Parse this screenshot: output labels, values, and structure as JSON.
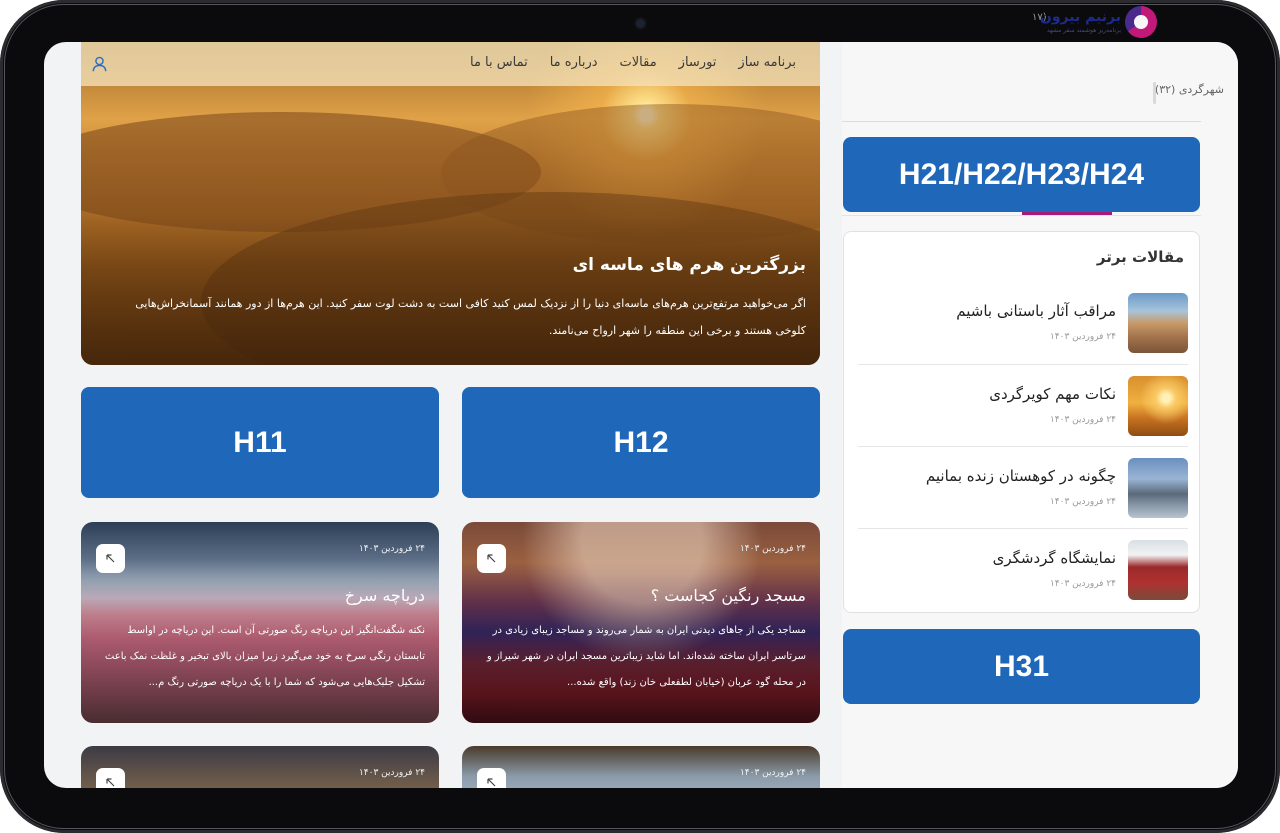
{
  "nav": {
    "links": [
      "برنامه ساز",
      "تورساز",
      "مقالات",
      "درباره ما",
      "تماس با ما"
    ]
  },
  "hero": {
    "title": "بزرگترین هرم های ماسه ای",
    "text": "اگر می‌خواهید مرتفع‌ترین هرم‌های ماسه‌ای دنیا را از نزدیک لمس کنید کافی است به دشت لوت سفر کنید. این هرم‌ها از دور همانند آسمانخراش‌هایی کلوخی هستند و برخی این منطقه را شهر ارواح می‌نامند."
  },
  "placeholders": {
    "h11": "H11",
    "h12": "H12",
    "h21_24": "H21/H22/H23/H24",
    "h31": "H31"
  },
  "cards": [
    {
      "date": "۲۴ فروردین ۱۴۰۳",
      "title": "دریاچه سرخ",
      "text": "نکته شگفت‌انگیز این دریاچه رنگ صورتی آن است. این دریاچه در اواسط تابستان رنگی سرخ به خود می‌گیرد زیرا میزان بالای تبخیر و غلظت نمک باعث تشکیل جلبک‌هایی می‌شود که شما را با یک دریاچه صورتی رنگ م..."
    },
    {
      "date": "۲۴ فروردین ۱۴۰۳",
      "title": "مسجد رنگین کجاست ؟",
      "text": "مساجد یکی از جاهای دیدنی ایران به شمار می‌روند و مساجد زیبای زیادی در سرتاسر ایران ساخته شده‌اند. اما شاید زیباترین مسجد ایران در شهر شیراز و در محله گود عربان (خیابان لطفعلی خان زند) واقع شده..."
    },
    {
      "date": "۲۴ فروردین ۱۴۰۳"
    },
    {
      "date": "۲۴ فروردین ۱۴۰۳"
    }
  ],
  "sidebar": {
    "logo_name": "برنیم بیرون",
    "logo_sub": "برنامه‌ریز هوشمند سفر   مشهد",
    "count_top": "(۱۷",
    "city_category": "شهرگردی (۳۲)",
    "top_articles_title": "مقالات برتر",
    "top_articles": [
      {
        "title": "مراقب آثار باستانی باشیم",
        "date": "۲۴ فروردین ۱۴۰۳"
      },
      {
        "title": "نکات مهم کویرگردی",
        "date": "۲۴ فروردین ۱۴۰۳"
      },
      {
        "title": "چگونه در کوهستان زنده بمانیم",
        "date": "۲۴ فروردین ۱۴۰۳"
      },
      {
        "title": "نمایشگاه گردشگری",
        "date": "۲۴ فروردین ۱۴۰۳"
      }
    ]
  },
  "colors": {
    "placeholder_blue": "#1f67b8",
    "accent_magenta": "#a8187a",
    "logo_navy": "#1d2c8c"
  }
}
